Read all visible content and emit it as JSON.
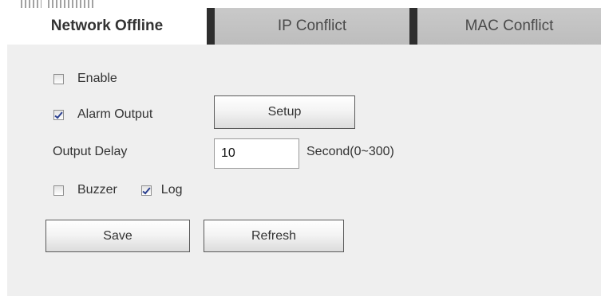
{
  "tabs": [
    {
      "label": "Network Offline",
      "active": true
    },
    {
      "label": "IP Conflict",
      "active": false
    },
    {
      "label": "MAC Conflict",
      "active": false
    }
  ],
  "form": {
    "enable": {
      "label": "Enable",
      "checked": false
    },
    "alarm_output": {
      "label": "Alarm Output",
      "checked": true
    },
    "setup_button": "Setup",
    "output_delay": {
      "label": "Output Delay",
      "value": "10",
      "unit": "Second(0~300)"
    },
    "buzzer": {
      "label": "Buzzer",
      "checked": false
    },
    "log": {
      "label": "Log",
      "checked": true
    }
  },
  "actions": {
    "save_label": "Save",
    "refresh_label": "Refresh"
  },
  "colors": {
    "panel_bg": "#efefef",
    "tab_inactive_bg": "#c4c4c4",
    "tab_separator": "#2e2e2e",
    "check_mark": "#2a3f8f"
  }
}
